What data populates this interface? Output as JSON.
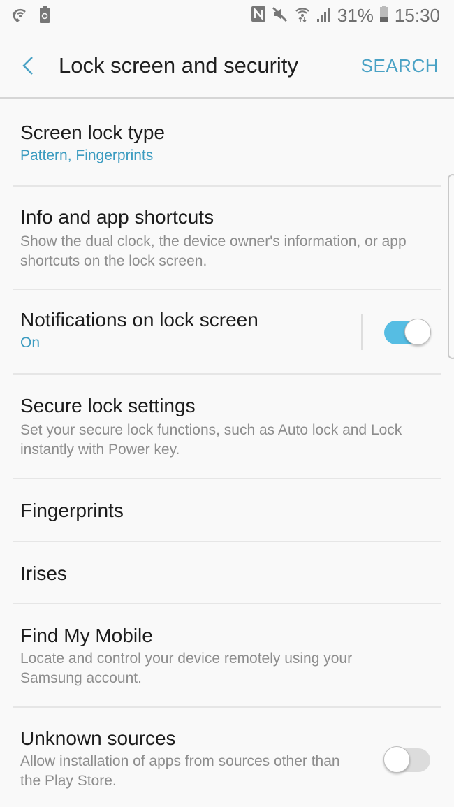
{
  "status_bar": {
    "left_icons": [
      "wifi-calling-icon",
      "battery-saver-icon"
    ],
    "right_icons": [
      "nfc-icon",
      "mute-icon",
      "wifi-icon",
      "signal-icon"
    ],
    "battery_percent": "31%",
    "battery_level": 0.31,
    "time": "15:30"
  },
  "app_bar": {
    "back_icon": "chevron-left-icon",
    "title": "Lock screen and security",
    "search_label": "SEARCH"
  },
  "colors": {
    "accent": "#4aa2c5",
    "toggle_on": "#56bde3",
    "toggle_off": "#dcdcdc",
    "background": "#f9f9f9"
  },
  "settings": [
    {
      "title": "Screen lock type",
      "subtitle": "Pattern, Fingerprints",
      "subtitle_accent": true
    },
    {
      "title": "Info and app shortcuts",
      "subtitle": "Show the dual clock, the device owner's information, or app shortcuts on the lock screen."
    },
    {
      "title": "Notifications on lock screen",
      "subtitle": "On",
      "subtitle_accent": true,
      "toggle": true
    },
    {
      "title": "Secure lock settings",
      "subtitle": "Set your secure lock functions, such as Auto lock and Lock instantly with Power key."
    },
    {
      "title": "Fingerprints"
    },
    {
      "title": "Irises"
    },
    {
      "title": "Find My Mobile",
      "subtitle": "Locate and control your device remotely using your Samsung account."
    },
    {
      "title": "Unknown sources",
      "subtitle": "Allow installation of apps from sources other than the Play Store.",
      "toggle": false
    }
  ]
}
